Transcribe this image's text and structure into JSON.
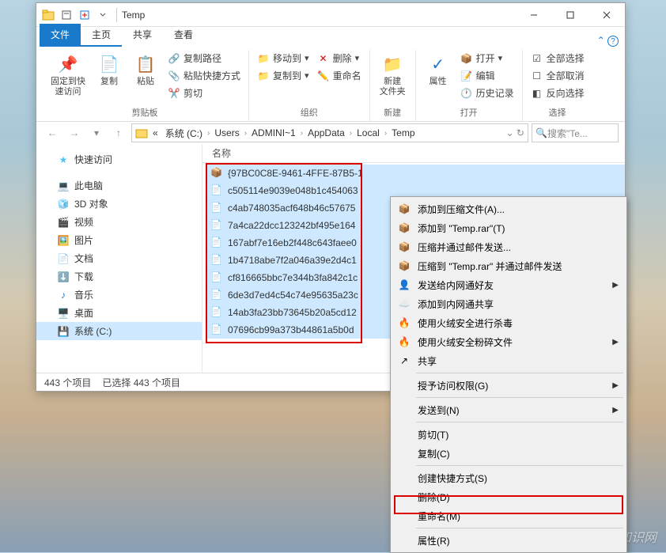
{
  "window": {
    "title": "Temp"
  },
  "tabs": {
    "file": "文件",
    "home": "主页",
    "share": "共享",
    "view": "查看"
  },
  "ribbon": {
    "pin": "固定到快\n速访问",
    "copy": "复制",
    "paste": "粘贴",
    "cut": "剪切",
    "copy_path": "复制路径",
    "paste_shortcut": "粘贴快捷方式",
    "clipboard_label": "剪贴板",
    "move_to": "移动到",
    "copy_to": "复制到",
    "delete": "删除",
    "rename": "重命名",
    "organize_label": "组织",
    "new_folder": "新建\n文件夹",
    "new_label": "新建",
    "properties": "属性",
    "open": "打开",
    "edit": "编辑",
    "history": "历史记录",
    "open_label": "打开",
    "select_all": "全部选择",
    "select_none": "全部取消",
    "invert_sel": "反向选择",
    "select_label": "选择"
  },
  "breadcrumb": {
    "parts": [
      "系统 (C:)",
      "Users",
      "ADMINI~1",
      "AppData",
      "Local",
      "Temp"
    ],
    "prefix": "«"
  },
  "search": {
    "placeholder": "搜索\"Te..."
  },
  "nav": {
    "quick": "快速访问",
    "pc": "此电脑",
    "objects3d": "3D 对象",
    "video": "视频",
    "pictures": "图片",
    "documents": "文档",
    "downloads": "下载",
    "music": "音乐",
    "desktop": "桌面",
    "system_c": "系统 (C:)"
  },
  "files": {
    "col_name": "名称",
    "rows": [
      "{97BC0C8E-9461-4FFE-87B5-1",
      "c505114e9039e048b1c454063",
      "c4ab748035acf648b46c57675",
      "7a4ca22dcc123242bf495e164",
      "167abf7e16eb2f448c643faee0",
      "1b4718abe7f2a046a39e2d4c1",
      "cf816665bbc7e344b3fa842c1c",
      "6de3d7ed4c54c74e95635a23c",
      "14ab3fa23bb73645b20a5cd12",
      "07696cb99a373b44861a5b0d"
    ]
  },
  "status": {
    "items": "443 个项目",
    "selected": "已选择 443 个项目"
  },
  "ctx": {
    "add_archive": "添加到压缩文件(A)...",
    "add_temp_rar": "添加到 \"Temp.rar\"(T)",
    "compress_email": "压缩并通过邮件发送...",
    "compress_temp_email": "压缩到 \"Temp.rar\" 并通过邮件发送",
    "send_friend": "发送给内网通好友",
    "add_share": "添加到内网通共享",
    "scan": "使用火绒安全进行杀毒",
    "shred": "使用火绒安全粉碎文件",
    "share": "共享",
    "grant_access": "授予访问权限(G)",
    "send_to": "发送到(N)",
    "cut": "剪切(T)",
    "copy": "复制(C)",
    "shortcut": "创建快捷方式(S)",
    "delete": "删除(D)",
    "rename": "重命名(M)",
    "properties": "属性(R)"
  },
  "watermark": "爱创根知识网"
}
